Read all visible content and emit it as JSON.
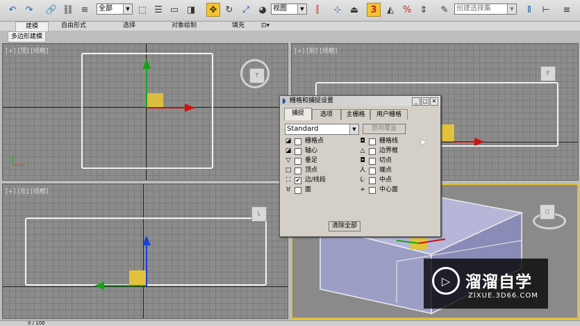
{
  "toolbar": {
    "selection_filter": "全部",
    "reference_coord": "视图",
    "named_selection_set": "创建选择集",
    "snap_toggle_label": "3"
  },
  "ribbon": {
    "tabs": [
      "建模",
      "自由形式",
      "选择",
      "对象绘制",
      "填充"
    ],
    "subtab": "多边形建模"
  },
  "viewports": {
    "top_label": "[+] [顶] [线框]",
    "front_label": "[+] [前] [线框]",
    "left_label": "[+] [左] [线框]",
    "persp_label": ""
  },
  "dialog": {
    "title": "栅格和捕捉设置",
    "tabs": [
      "捕捉",
      "选项",
      "主栅格",
      "用户栅格"
    ],
    "dropdown_value": "Standard",
    "override_button": "禁用覆盖",
    "left_items": [
      {
        "icon": "◪",
        "label": "栅格点",
        "checked": false
      },
      {
        "icon": "◪",
        "label": "轴心",
        "checked": false
      },
      {
        "icon": "▽",
        "label": "垂足",
        "checked": false
      },
      {
        "icon": "□",
        "label": "顶点",
        "checked": false
      },
      {
        "icon": "⛶",
        "label": "边/线段",
        "checked": true
      },
      {
        "icon": "♉",
        "label": "面",
        "checked": false
      }
    ],
    "right_items": [
      {
        "icon": "◘",
        "label": "栅格线",
        "checked": false
      },
      {
        "icon": "△",
        "label": "边界框",
        "checked": false
      },
      {
        "icon": "◘",
        "label": "切点",
        "checked": false
      },
      {
        "icon": "人",
        "label": "端点",
        "checked": false
      },
      {
        "icon": "ᒷ",
        "label": "中点",
        "checked": false
      },
      {
        "icon": "+",
        "label": "中心面",
        "checked": false
      }
    ],
    "clear_all_button": "清除全部"
  },
  "watermark": {
    "brand": "溜溜自学",
    "url": "ZIXUE.3D66.COM"
  },
  "status": {
    "frame": "0 / 100"
  }
}
